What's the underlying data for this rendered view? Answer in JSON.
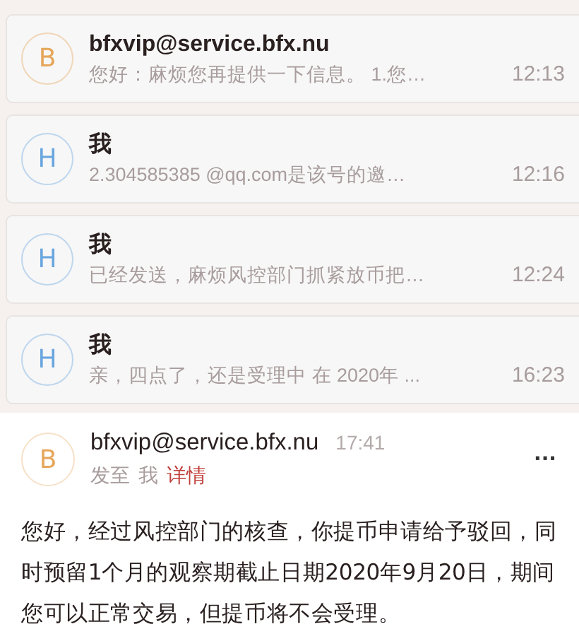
{
  "conversation": [
    {
      "avatar": "B",
      "color": "#e6a65a",
      "sender": "bfxvip@service.bfx.nu",
      "preview": "您好：麻烦您再提供一下信息。 1.您…",
      "time": "12:13"
    },
    {
      "avatar": "H",
      "color": "#6aa6df",
      "sender": "我",
      "preview": "2.304585385 @qq.com是该号的邀…",
      "time": "12:16"
    },
    {
      "avatar": "H",
      "color": "#6aa6df",
      "sender": "我",
      "preview": "已经发送，麻烦风控部门抓紧放币把…",
      "time": "12:24"
    },
    {
      "avatar": "H",
      "color": "#6aa6df",
      "sender": "我",
      "preview": "亲，四点了，还是受理中 在 2020年 ...",
      "time": "16:23"
    }
  ],
  "open_message": {
    "avatar": "B",
    "color": "#e6a65a",
    "sender": "bfxvip@service.bfx.nu",
    "time": "17:41",
    "sent_to_label": "发至",
    "recipient": "我",
    "details_link": "详情",
    "more": "···",
    "body": "您好，经过风控部门的核查，你提币申请给予驳回，同时预留1个月的观察期截止日期2020年9月20日，期间您可以正常交易，但提币将不会受理。"
  }
}
